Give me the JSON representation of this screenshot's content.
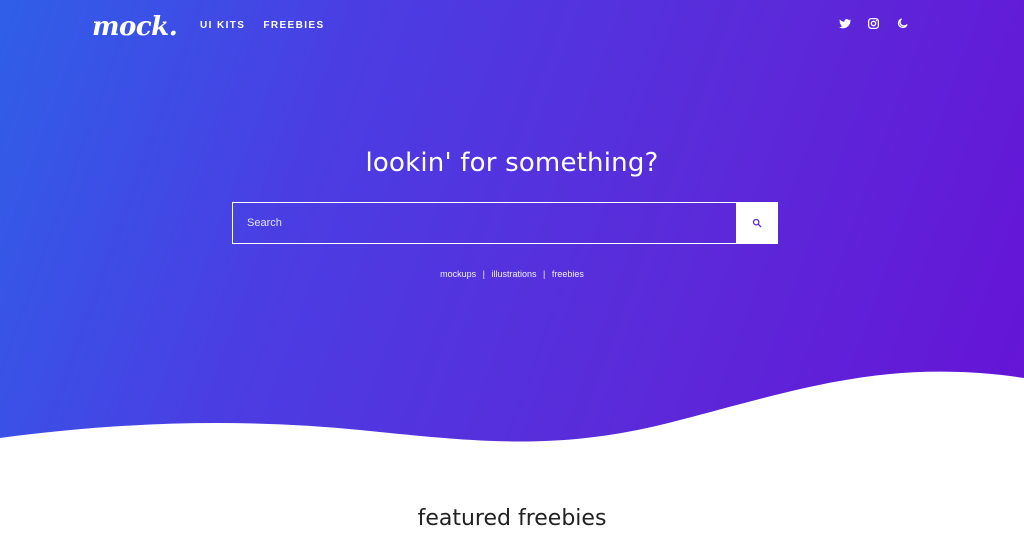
{
  "brand": {
    "logo_text": "mock."
  },
  "nav": {
    "items": [
      {
        "label": "UI KITS"
      },
      {
        "label": "FREEBIES"
      }
    ]
  },
  "social": {
    "icons": [
      "twitter-icon",
      "instagram-icon",
      "moon-icon"
    ]
  },
  "hero": {
    "headline": "lookin' for something?",
    "search": {
      "placeholder": "Search",
      "value": ""
    },
    "tags": [
      {
        "label": "mockups"
      },
      {
        "label": "illustrations"
      },
      {
        "label": "freebies"
      }
    ],
    "tag_separator": "|"
  },
  "featured": {
    "title": "featured freebies"
  },
  "colors": {
    "gradient_start": "#2f5fe8",
    "gradient_end": "#6613d6",
    "text_light": "#ffffff",
    "text_dark": "#222222",
    "background": "#ffffff"
  }
}
